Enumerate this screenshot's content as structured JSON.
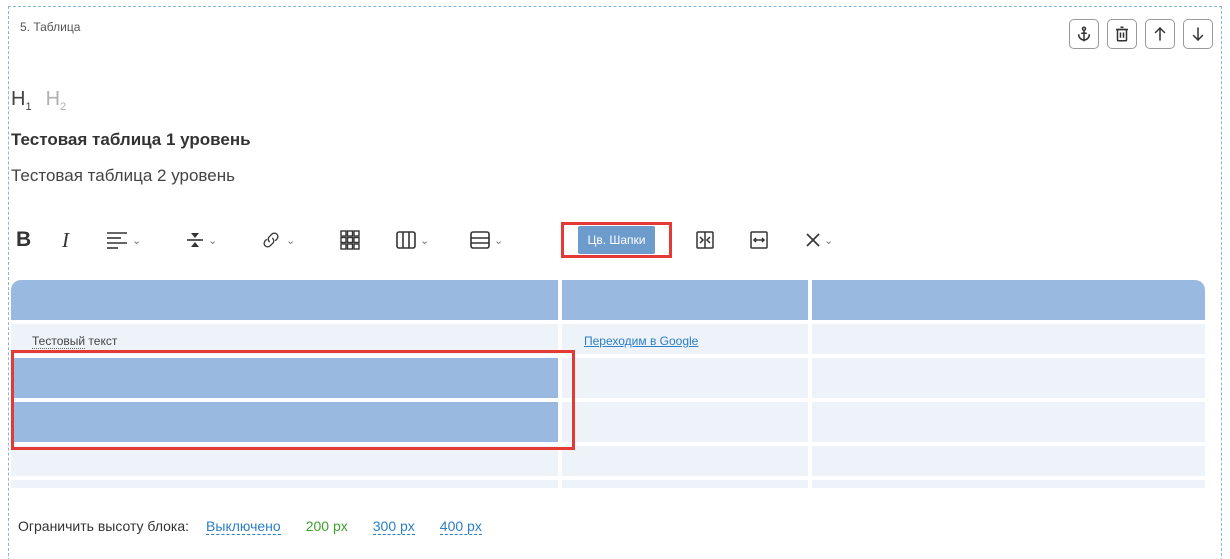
{
  "block": {
    "title": "5. Таблица"
  },
  "tools": {
    "anchor_icon": "anchor-icon",
    "delete_icon": "trash-icon",
    "up_icon": "arrow-up-icon",
    "down_icon": "arrow-down-icon"
  },
  "headings": {
    "h1": "H",
    "h1_sub": "1",
    "h2": "H",
    "h2_sub": "2"
  },
  "titles": {
    "level1": "Тестовая таблица 1 уровень",
    "level2": "Тестовая таблица 2 уровень"
  },
  "toolbar": {
    "bold": "B",
    "italic": "I",
    "color_header_button": "Цв. Шапки"
  },
  "table": {
    "rows": [
      {
        "cells": [
          "",
          "",
          ""
        ]
      },
      {
        "cells": [
          "Тестовый текст",
          "Переходим в Google",
          ""
        ]
      },
      {
        "cells": [
          "",
          "",
          ""
        ]
      },
      {
        "cells": [
          "",
          "",
          ""
        ]
      },
      {
        "cells": [
          "",
          "",
          ""
        ]
      }
    ],
    "row2_text_part1": "Тестовый",
    "row2_text_part2": " текст",
    "link_text": "Переходим в Google",
    "header_color": "#9ab9e0",
    "cell_color": "#eef2f9"
  },
  "limit": {
    "label": "Ограничить высоту блока:",
    "options": [
      "Выключено",
      "200 px",
      "300 px",
      "400 px"
    ],
    "active_color": "#3ea12b",
    "link_color": "#2a7ec8"
  }
}
